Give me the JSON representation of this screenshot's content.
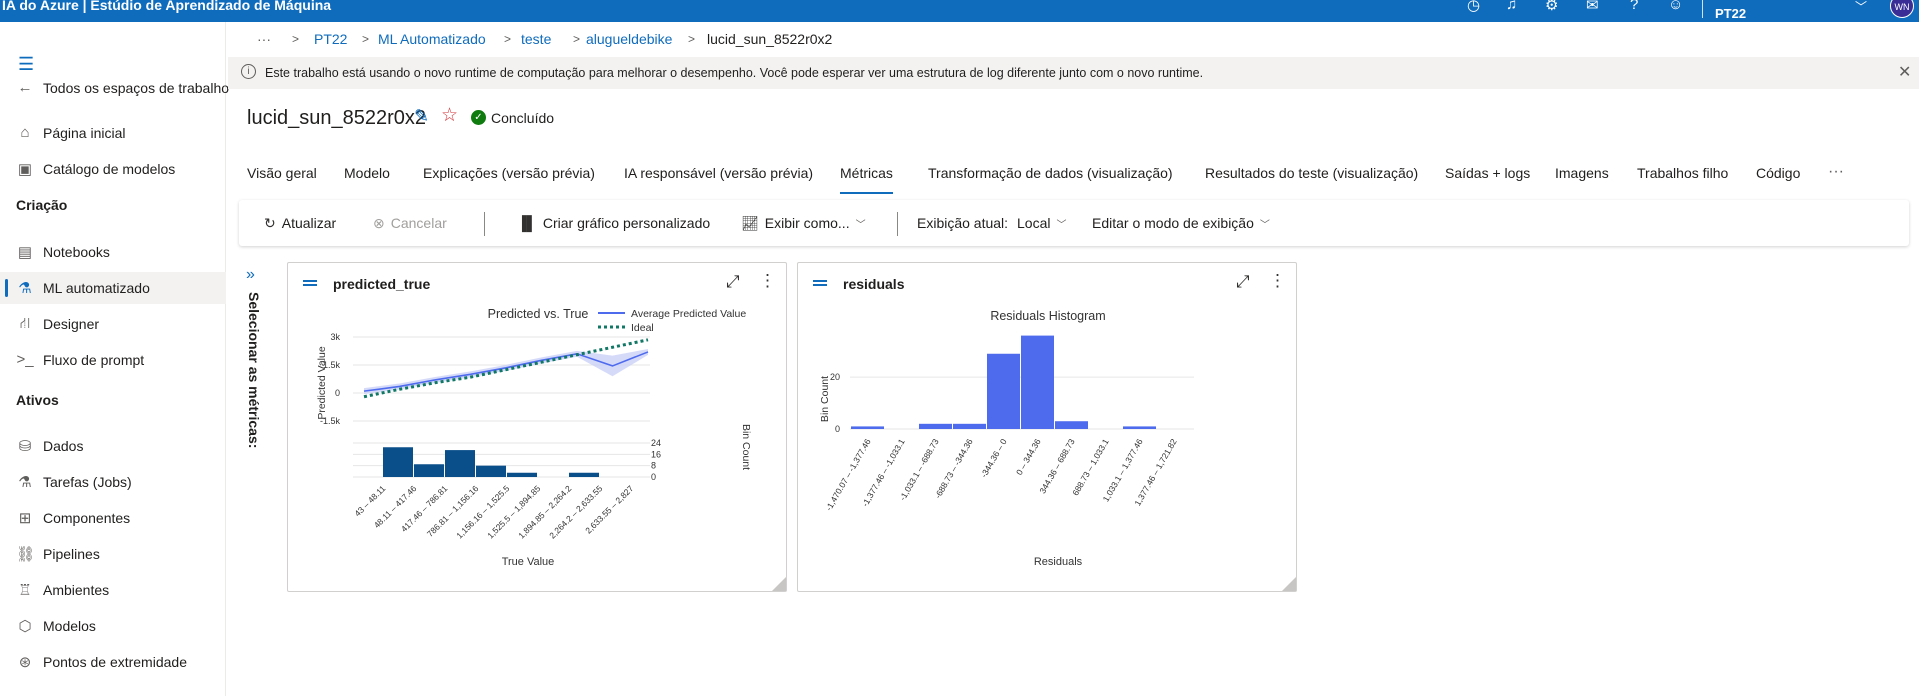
{
  "topbar": {
    "title": "IA do Azure | Estúdio de Aprendizado de Máquina",
    "workspace": "PT22",
    "avatar": "WN",
    "icons": [
      "clock-icon",
      "bell-icon",
      "gear-icon",
      "feedback-icon",
      "help-icon",
      "smiley-icon",
      "chevron-down-icon"
    ]
  },
  "sidebar": {
    "back_label": "Todos os espaços de trabalho",
    "items_top": [
      {
        "label": "Página inicial",
        "icon": "home-icon"
      },
      {
        "label": "Catálogo de modelos",
        "icon": "catalog-icon"
      }
    ],
    "section_creation": "Criação",
    "items_creation": [
      {
        "label": "Notebooks",
        "icon": "notebook-icon"
      },
      {
        "label": "ML automatizado",
        "icon": "automl-icon"
      },
      {
        "label": "Designer",
        "icon": "designer-icon"
      },
      {
        "label": "Fluxo de prompt",
        "icon": "prompt-flow-icon"
      }
    ],
    "section_assets": "Ativos",
    "items_assets": [
      {
        "label": "Dados",
        "icon": "data-icon"
      },
      {
        "label": "Tarefas (Jobs)",
        "icon": "jobs-icon"
      },
      {
        "label": "Componentes",
        "icon": "components-icon"
      },
      {
        "label": "Pipelines",
        "icon": "pipelines-icon"
      },
      {
        "label": "Ambientes",
        "icon": "environments-icon"
      },
      {
        "label": "Modelos",
        "icon": "models-icon"
      },
      {
        "label": "Pontos de extremidade",
        "icon": "endpoints-icon"
      }
    ]
  },
  "breadcrumb": {
    "more": "···",
    "items": [
      "PT22",
      "ML Automatizado",
      "teste",
      "alugueldebike"
    ],
    "current": "lucid_sun_8522r0x2"
  },
  "banner": {
    "text": "Este trabalho está usando o novo runtime de computação para melhorar o desempenho. Você pode esperar ver uma estrutura de log diferente junto com o novo runtime."
  },
  "job": {
    "name": "lucid_sun_8522r0x2",
    "status": "Concluído"
  },
  "tabs": [
    "Visão geral",
    "Modelo",
    "Explicações (versão prévia)",
    "IA responsável (versão prévia)",
    "Métricas",
    "Transformação de dados (visualização)",
    "Resultados do teste (visualização)",
    "Saídas + logs",
    "Imagens",
    "Trabalhos filho",
    "Código"
  ],
  "active_tab": "Métricas",
  "toolbar": {
    "refresh": "Atualizar",
    "cancel": "Cancelar",
    "custom_chart": "Criar gráfico personalizado",
    "view_as": "Exibir como...",
    "current_view_label": "Exibição atual:",
    "current_view_value": "Local",
    "edit_view": "Editar o modo de exibição"
  },
  "metrics_panel_label": "Selecionar as métricas:",
  "charts": {
    "predicted_true": {
      "card_title": "predicted_true",
      "title": "Predicted vs. True",
      "legend": [
        "Average Predicted Value",
        "Ideal"
      ],
      "ylabel": "Predicted Value",
      "xlabel": "True Value",
      "y2label": "Bin Count",
      "yticks": [
        "3k",
        "1.5k",
        "0",
        "-1.5k"
      ],
      "y2ticks": [
        "24",
        "16",
        "8",
        "0"
      ],
      "categories": [
        "43 – 48.11",
        "48.11 – 417.46",
        "417.46 – 786.81",
        "786.81 – 1,156.16",
        "1,156.16 – 1,525.5",
        "1,525.5 – 1,894.85",
        "1,894.85 – 2,264.2",
        "2,264.2 – 2,633.55",
        "2,633.55 – 2,827"
      ]
    },
    "residuals": {
      "card_title": "residuals",
      "title": "Residuals Histogram",
      "ylabel": "Bin Count",
      "xlabel": "Residuals",
      "yticks": [
        "20",
        "0"
      ],
      "categories": [
        "-1,470.07 – -1,377.46",
        "-1,377.46 – -1,033.1",
        "-1,033.1 – -688.73",
        "-688.73 – -344.36",
        "-344.36 – 0",
        "0 – 344.36",
        "344.36 – 688.73",
        "688.73 – 1,033.1",
        "1,033.1 – 1,377.46",
        "1,377.46 – 1,721.82"
      ]
    }
  },
  "chart_data": [
    {
      "type": "line",
      "title": "Predicted vs. True",
      "xlabel": "True Value",
      "ylabel": "Predicted Value",
      "ylim": [
        -1500,
        3000
      ],
      "categories": [
        "43 – 48.11",
        "48.11 – 417.46",
        "417.46 – 786.81",
        "786.81 – 1,156.16",
        "1,156.16 – 1,525.5",
        "1,525.5 – 1,894.85",
        "1,894.85 – 2,264.2",
        "2,264.2 – 2,633.55",
        "2,633.55 – 2,827"
      ],
      "series": [
        {
          "name": "Average Predicted Value",
          "values": [
            100,
            350,
            700,
            1000,
            1350,
            1750,
            2100,
            1450,
            2200
          ]
        },
        {
          "name": "Ideal",
          "values": [
            -200,
            200,
            550,
            850,
            1250,
            1650,
            2050,
            2450,
            2850
          ]
        }
      ],
      "histogram": {
        "ylabel": "Bin Count",
        "ylim": [
          0,
          24
        ],
        "values": [
          21,
          9,
          19,
          8,
          3,
          0,
          3,
          0,
          0
        ]
      }
    },
    {
      "type": "bar",
      "title": "Residuals Histogram",
      "xlabel": "Residuals",
      "ylabel": "Bin Count",
      "ylim": [
        0,
        37
      ],
      "categories": [
        "-1,470.07 – -1,377.46",
        "-1,377.46 – -1,033.1",
        "-1,033.1 – -688.73",
        "-688.73 – -344.36",
        "-344.36 – 0",
        "0 – 344.36",
        "344.36 – 688.73",
        "688.73 – 1,033.1",
        "1,033.1 – 1,377.46",
        "1,377.46 – 1,721.82"
      ],
      "values": [
        1,
        0,
        2,
        2,
        29,
        36,
        3,
        0,
        1,
        0
      ]
    }
  ],
  "colors": {
    "accent": "#0f6cbd",
    "hist_dark": "#0b4f8a",
    "residual_bar": "#4f6bed",
    "ideal": "#117865",
    "avg_line": "#4f6bed"
  }
}
